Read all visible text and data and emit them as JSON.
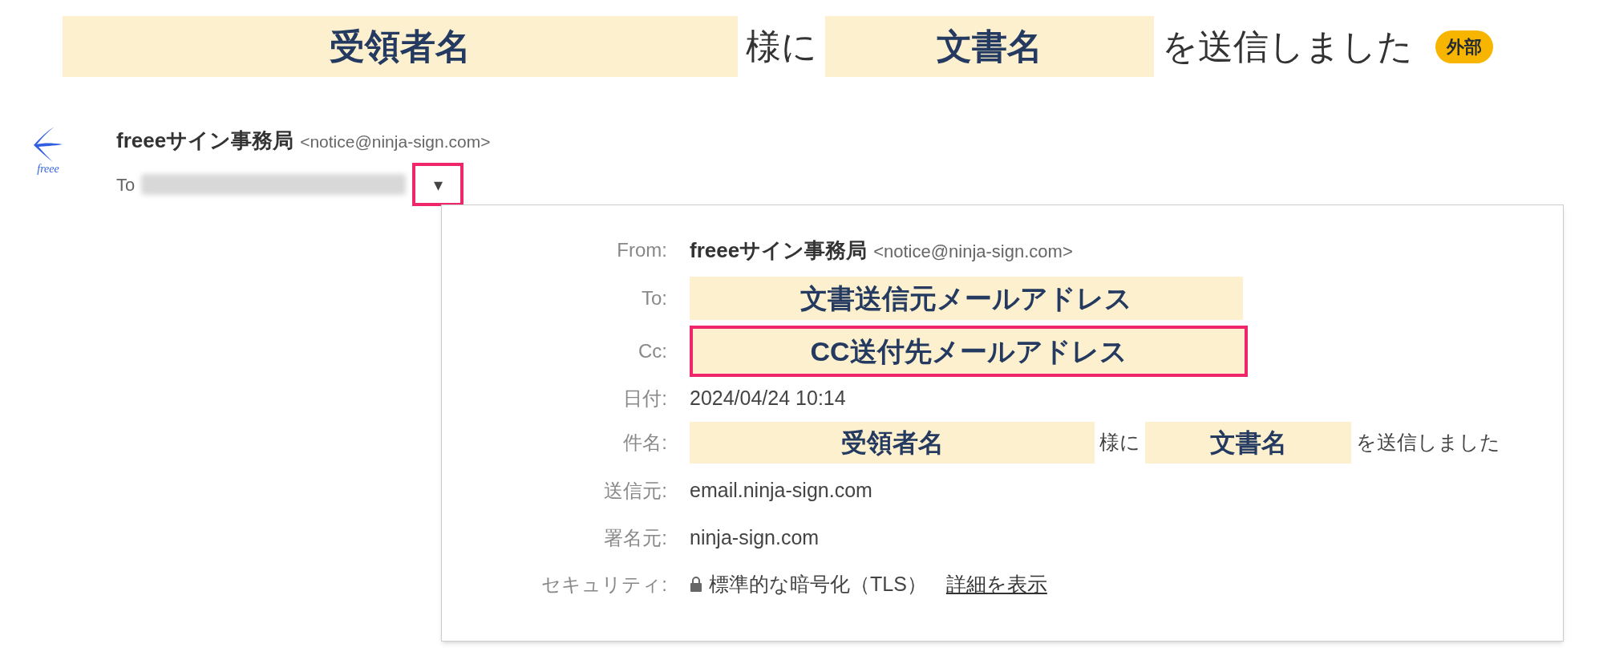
{
  "heading": {
    "parts": [
      {
        "kind": "highlight",
        "text": "受領者名"
      },
      {
        "kind": "plain",
        "text": "様に"
      },
      {
        "kind": "highlight",
        "text": "文書名"
      },
      {
        "kind": "plain",
        "text": "を送信しました"
      }
    ],
    "badge": "外部"
  },
  "sender": {
    "logo_text": "freee",
    "name": "freeeサイン事務局",
    "email": "<notice@ninja-sign.com>",
    "to_label": "To",
    "caret": "▾",
    "caret_outlined": true
  },
  "details": [
    {
      "kind": "sender",
      "label": "From:",
      "name": "freeeサイン事務局",
      "email": "<notice@ninja-sign.com>"
    },
    {
      "kind": "highlight",
      "label": "To:",
      "text": "文書送信元メールアドレス",
      "outlined": false
    },
    {
      "kind": "highlight",
      "label": "Cc:",
      "text": "CC送付先メールアドレス",
      "outlined": true
    },
    {
      "kind": "plain",
      "label": "日付:",
      "text": "2024/04/24 10:14"
    },
    {
      "kind": "subject",
      "label": "件名:",
      "parts": [
        {
          "kind": "highlight",
          "text": "受領者名"
        },
        {
          "kind": "plain",
          "text": "様に"
        },
        {
          "kind": "highlight",
          "text": "文書名"
        },
        {
          "kind": "plain",
          "text": "を送信しました"
        }
      ]
    },
    {
      "kind": "plain",
      "label": "送信元:",
      "text": "email.ninja-sign.com"
    },
    {
      "kind": "plain",
      "label": "署名元:",
      "text": "ninja-sign.com"
    },
    {
      "kind": "security",
      "label": "セキュリティ:",
      "text": "標準的な暗号化（TLS）",
      "link": "詳細を表示"
    }
  ]
}
